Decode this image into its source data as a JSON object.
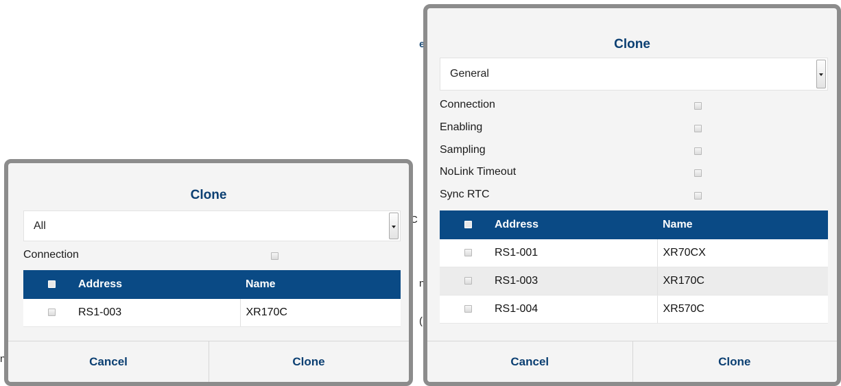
{
  "background_fragments": [
    "e",
    "C",
    "n",
    "(",
    "n"
  ],
  "dialog_left": {
    "title": "Clone",
    "filter": {
      "selected": "All"
    },
    "options": [
      {
        "label": "Connection",
        "checked": false
      }
    ],
    "table": {
      "headers": {
        "address": "Address",
        "name": "Name"
      },
      "rows": [
        {
          "address": "RS1-003",
          "name": "XR170C",
          "checked": false
        }
      ]
    },
    "buttons": {
      "cancel": "Cancel",
      "clone": "Clone"
    }
  },
  "dialog_right": {
    "title": "Clone",
    "filter": {
      "selected": "General"
    },
    "options": [
      {
        "label": "Connection",
        "checked": false
      },
      {
        "label": "Enabling",
        "checked": false
      },
      {
        "label": "Sampling",
        "checked": false
      },
      {
        "label": "NoLink Timeout",
        "checked": false
      },
      {
        "label": "Sync RTC",
        "checked": false
      }
    ],
    "table": {
      "headers": {
        "address": "Address",
        "name": "Name"
      },
      "rows": [
        {
          "address": "RS1-001",
          "name": "XR70CX",
          "checked": false
        },
        {
          "address": "RS1-003",
          "name": "XR170C",
          "checked": false
        },
        {
          "address": "RS1-004",
          "name": "XR570C",
          "checked": false
        }
      ]
    },
    "buttons": {
      "cancel": "Cancel",
      "clone": "Clone"
    }
  },
  "colors": {
    "accent": "#0a4a85",
    "title": "#0b3f72",
    "dialog_bg": "#f4f4f4",
    "frame": "#8c8c8c"
  }
}
